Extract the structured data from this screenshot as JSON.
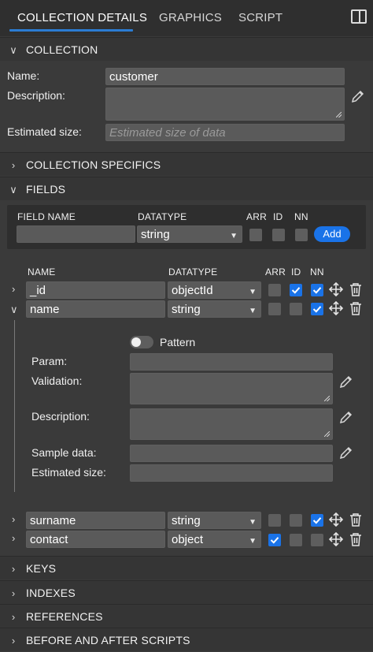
{
  "tabs": [
    {
      "label": "COLLECTION DETAILS",
      "active": true
    },
    {
      "label": "GRAPHICS",
      "active": false
    },
    {
      "label": "SCRIPT",
      "active": false
    }
  ],
  "collection_section": {
    "title": "COLLECTION",
    "name_label": "Name:",
    "name_value": "customer",
    "description_label": "Description:",
    "description_value": "",
    "size_label": "Estimated size:",
    "size_placeholder": "Estimated size of data"
  },
  "collection_specifics": {
    "title": "COLLECTION SPECIFICS"
  },
  "fields_section": {
    "title": "FIELDS",
    "new_field": {
      "name_header": "FIELD NAME",
      "type_header": "DATATYPE",
      "arr_header": "ARR",
      "id_header": "ID",
      "nn_header": "NN",
      "name_value": "",
      "type_value": "string",
      "add_label": "Add"
    },
    "list_headers": {
      "name": "NAME",
      "type": "DATATYPE",
      "arr": "ARR",
      "id": "ID",
      "nn": "NN"
    },
    "rows": [
      {
        "name": "_id",
        "type": "objectId",
        "arr": false,
        "id": true,
        "nn": true,
        "expanded": false
      },
      {
        "name": "name",
        "type": "string",
        "arr": false,
        "id": false,
        "nn": true,
        "expanded": true
      },
      {
        "name": "surname",
        "type": "string",
        "arr": false,
        "id": false,
        "nn": true,
        "expanded": false
      },
      {
        "name": "contact",
        "type": "object",
        "arr": true,
        "id": false,
        "nn": false,
        "expanded": false
      }
    ],
    "detail": {
      "pattern_label": "Pattern",
      "pattern_on": false,
      "param_label": "Param:",
      "validation_label": "Validation:",
      "description_label": "Description:",
      "sample_label": "Sample data:",
      "size_label": "Estimated size:"
    }
  },
  "sections_bottom": [
    {
      "title": "KEYS"
    },
    {
      "title": "INDEXES"
    },
    {
      "title": "REFERENCES"
    },
    {
      "title": "BEFORE AND AFTER SCRIPTS"
    }
  ],
  "colors": {
    "accent": "#1a73e8",
    "background": "#3a3a3a",
    "input": "#5a5a5a"
  }
}
